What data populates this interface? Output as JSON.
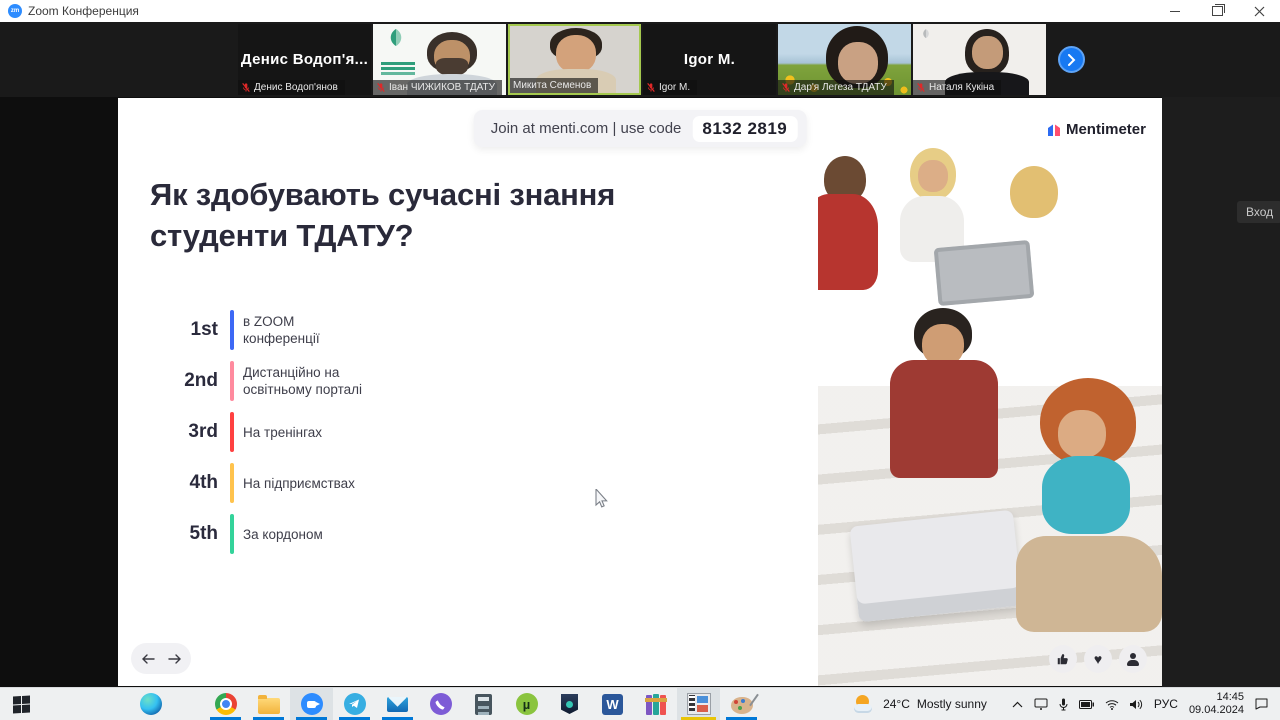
{
  "window": {
    "title": "Zoom Конференция"
  },
  "participants": [
    {
      "name": "Денис Водоп'янов",
      "display_text": "Денис Водоп'я...",
      "muted": true
    },
    {
      "name": "Іван ЧИЖИКОВ ТДАТУ",
      "muted": true
    },
    {
      "name": "Микита Семенов",
      "muted": false
    },
    {
      "name": "Igor M.",
      "display_text": "Igor M.",
      "muted": true
    },
    {
      "name": "Дар'я Легеза ТДАТУ",
      "muted": true
    },
    {
      "name": "Наталя Кукіна",
      "muted": true
    }
  ],
  "slide": {
    "join_text": "Join at menti.com | use code",
    "join_code": "8132 2819",
    "title": "Як здобувають сучасні знання студенти ТДАТУ?",
    "brand": "Mentimeter",
    "rankings": [
      {
        "rank": "1st",
        "label": "в ZOOM\nконференції",
        "color": "#3d68f5"
      },
      {
        "rank": "2nd",
        "label": "Дистанційно на\nосвітньому порталі",
        "color": "#ff8a9e"
      },
      {
        "rank": "3rd",
        "label": "На тренінгах",
        "color": "#ff4141"
      },
      {
        "rank": "4th",
        "label": "На підприємствах",
        "color": "#ffc34d"
      },
      {
        "rank": "5th",
        "label": "За кордоном",
        "color": "#33d39a"
      }
    ]
  },
  "login_button": "Вход",
  "taskbar": {
    "apps": [
      "start",
      "edge",
      "chrome",
      "file-explorer",
      "zoom",
      "telegram",
      "mail",
      "viber",
      "calculator",
      "utorrent",
      "security-shield",
      "word",
      "winrar",
      "movie-maker",
      "paint"
    ],
    "tray": {
      "temperature": "24°C",
      "weather": "Mostly sunny",
      "language": "РУС",
      "time": "14:45",
      "date": "09.04.2024"
    }
  }
}
